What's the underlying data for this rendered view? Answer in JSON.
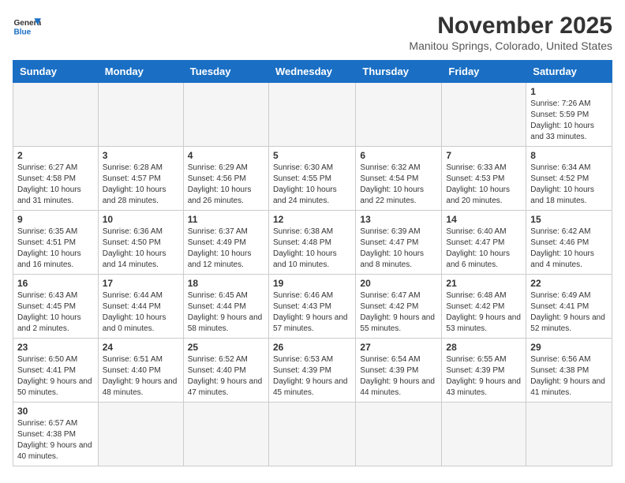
{
  "logo": {
    "text_general": "General",
    "text_blue": "Blue"
  },
  "header": {
    "month": "November 2025",
    "location": "Manitou Springs, Colorado, United States"
  },
  "days_of_week": [
    "Sunday",
    "Monday",
    "Tuesday",
    "Wednesday",
    "Thursday",
    "Friday",
    "Saturday"
  ],
  "weeks": [
    [
      {
        "day": "",
        "info": ""
      },
      {
        "day": "",
        "info": ""
      },
      {
        "day": "",
        "info": ""
      },
      {
        "day": "",
        "info": ""
      },
      {
        "day": "",
        "info": ""
      },
      {
        "day": "",
        "info": ""
      },
      {
        "day": "1",
        "info": "Sunrise: 7:26 AM\nSunset: 5:59 PM\nDaylight: 10 hours and 33 minutes."
      }
    ],
    [
      {
        "day": "2",
        "info": "Sunrise: 6:27 AM\nSunset: 4:58 PM\nDaylight: 10 hours and 31 minutes."
      },
      {
        "day": "3",
        "info": "Sunrise: 6:28 AM\nSunset: 4:57 PM\nDaylight: 10 hours and 28 minutes."
      },
      {
        "day": "4",
        "info": "Sunrise: 6:29 AM\nSunset: 4:56 PM\nDaylight: 10 hours and 26 minutes."
      },
      {
        "day": "5",
        "info": "Sunrise: 6:30 AM\nSunset: 4:55 PM\nDaylight: 10 hours and 24 minutes."
      },
      {
        "day": "6",
        "info": "Sunrise: 6:32 AM\nSunset: 4:54 PM\nDaylight: 10 hours and 22 minutes."
      },
      {
        "day": "7",
        "info": "Sunrise: 6:33 AM\nSunset: 4:53 PM\nDaylight: 10 hours and 20 minutes."
      },
      {
        "day": "8",
        "info": "Sunrise: 6:34 AM\nSunset: 4:52 PM\nDaylight: 10 hours and 18 minutes."
      }
    ],
    [
      {
        "day": "9",
        "info": "Sunrise: 6:35 AM\nSunset: 4:51 PM\nDaylight: 10 hours and 16 minutes."
      },
      {
        "day": "10",
        "info": "Sunrise: 6:36 AM\nSunset: 4:50 PM\nDaylight: 10 hours and 14 minutes."
      },
      {
        "day": "11",
        "info": "Sunrise: 6:37 AM\nSunset: 4:49 PM\nDaylight: 10 hours and 12 minutes."
      },
      {
        "day": "12",
        "info": "Sunrise: 6:38 AM\nSunset: 4:48 PM\nDaylight: 10 hours and 10 minutes."
      },
      {
        "day": "13",
        "info": "Sunrise: 6:39 AM\nSunset: 4:47 PM\nDaylight: 10 hours and 8 minutes."
      },
      {
        "day": "14",
        "info": "Sunrise: 6:40 AM\nSunset: 4:47 PM\nDaylight: 10 hours and 6 minutes."
      },
      {
        "day": "15",
        "info": "Sunrise: 6:42 AM\nSunset: 4:46 PM\nDaylight: 10 hours and 4 minutes."
      }
    ],
    [
      {
        "day": "16",
        "info": "Sunrise: 6:43 AM\nSunset: 4:45 PM\nDaylight: 10 hours and 2 minutes."
      },
      {
        "day": "17",
        "info": "Sunrise: 6:44 AM\nSunset: 4:44 PM\nDaylight: 10 hours and 0 minutes."
      },
      {
        "day": "18",
        "info": "Sunrise: 6:45 AM\nSunset: 4:44 PM\nDaylight: 9 hours and 58 minutes."
      },
      {
        "day": "19",
        "info": "Sunrise: 6:46 AM\nSunset: 4:43 PM\nDaylight: 9 hours and 57 minutes."
      },
      {
        "day": "20",
        "info": "Sunrise: 6:47 AM\nSunset: 4:42 PM\nDaylight: 9 hours and 55 minutes."
      },
      {
        "day": "21",
        "info": "Sunrise: 6:48 AM\nSunset: 4:42 PM\nDaylight: 9 hours and 53 minutes."
      },
      {
        "day": "22",
        "info": "Sunrise: 6:49 AM\nSunset: 4:41 PM\nDaylight: 9 hours and 52 minutes."
      }
    ],
    [
      {
        "day": "23",
        "info": "Sunrise: 6:50 AM\nSunset: 4:41 PM\nDaylight: 9 hours and 50 minutes."
      },
      {
        "day": "24",
        "info": "Sunrise: 6:51 AM\nSunset: 4:40 PM\nDaylight: 9 hours and 48 minutes."
      },
      {
        "day": "25",
        "info": "Sunrise: 6:52 AM\nSunset: 4:40 PM\nDaylight: 9 hours and 47 minutes."
      },
      {
        "day": "26",
        "info": "Sunrise: 6:53 AM\nSunset: 4:39 PM\nDaylight: 9 hours and 45 minutes."
      },
      {
        "day": "27",
        "info": "Sunrise: 6:54 AM\nSunset: 4:39 PM\nDaylight: 9 hours and 44 minutes."
      },
      {
        "day": "28",
        "info": "Sunrise: 6:55 AM\nSunset: 4:39 PM\nDaylight: 9 hours and 43 minutes."
      },
      {
        "day": "29",
        "info": "Sunrise: 6:56 AM\nSunset: 4:38 PM\nDaylight: 9 hours and 41 minutes."
      }
    ],
    [
      {
        "day": "30",
        "info": "Sunrise: 6:57 AM\nSunset: 4:38 PM\nDaylight: 9 hours and 40 minutes."
      },
      {
        "day": "",
        "info": ""
      },
      {
        "day": "",
        "info": ""
      },
      {
        "day": "",
        "info": ""
      },
      {
        "day": "",
        "info": ""
      },
      {
        "day": "",
        "info": ""
      },
      {
        "day": "",
        "info": ""
      }
    ]
  ]
}
